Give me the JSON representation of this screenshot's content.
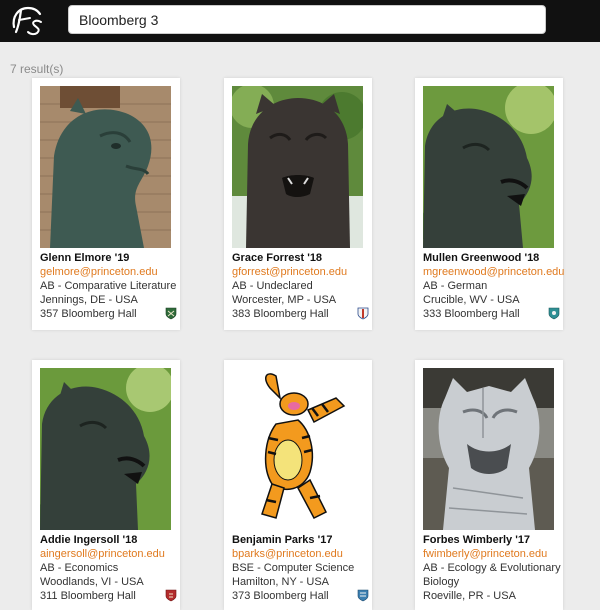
{
  "app": {
    "logo_text": "Fs"
  },
  "search": {
    "value": "Bloomberg 3"
  },
  "results_count": "7 result(s)",
  "cards": [
    {
      "name": "Glenn Elmore '19",
      "email": "gelmore@princeton.edu",
      "major": "AB - Comparative Literature",
      "hometown": "Jennings, DE - USA",
      "room": "357 Bloomberg Hall",
      "photo": "tiger-statue-photo",
      "crest": "green-shield-icon"
    },
    {
      "name": "Grace Forrest '18",
      "email": "gforrest@princeton.edu",
      "major": "AB - Undeclared",
      "hometown": "Worcester, MP - USA",
      "room": "383 Bloomberg Hall",
      "photo": "tiger-statue-photo",
      "crest": "blue-red-shield-icon"
    },
    {
      "name": "Mullen Greenwood '18",
      "email": "mgreenwood@princeton.edu",
      "major": "AB - German",
      "hometown": "Crucible, WV - USA",
      "room": "333 Bloomberg Hall",
      "photo": "tiger-statue-photo",
      "crest": "teal-shield-icon"
    },
    {
      "name": "Addie Ingersoll '18",
      "email": "aingersoll@princeton.edu",
      "major": "AB - Economics",
      "hometown": "Woodlands, VI - USA",
      "room": "311 Bloomberg Hall",
      "photo": "tiger-statue-photo",
      "crest": "red-shield-icon"
    },
    {
      "name": "Benjamin Parks '17",
      "email": "bparks@princeton.edu",
      "major": "BSE - Computer Science",
      "hometown": "Hamilton, NY - USA",
      "room": "373 Bloomberg Hall",
      "photo": "cartoon-tiger-photo",
      "crest": "blue-shield-icon"
    },
    {
      "name": "Forbes Wimberly '17",
      "email": "fwimberly@princeton.edu",
      "major": "AB - Ecology & Evolutionary",
      "major_cont": "Biology",
      "hometown": "Roeville, PR - USA",
      "room": "",
      "photo": "metal-tiger-sculpture-photo",
      "crest": ""
    }
  ]
}
